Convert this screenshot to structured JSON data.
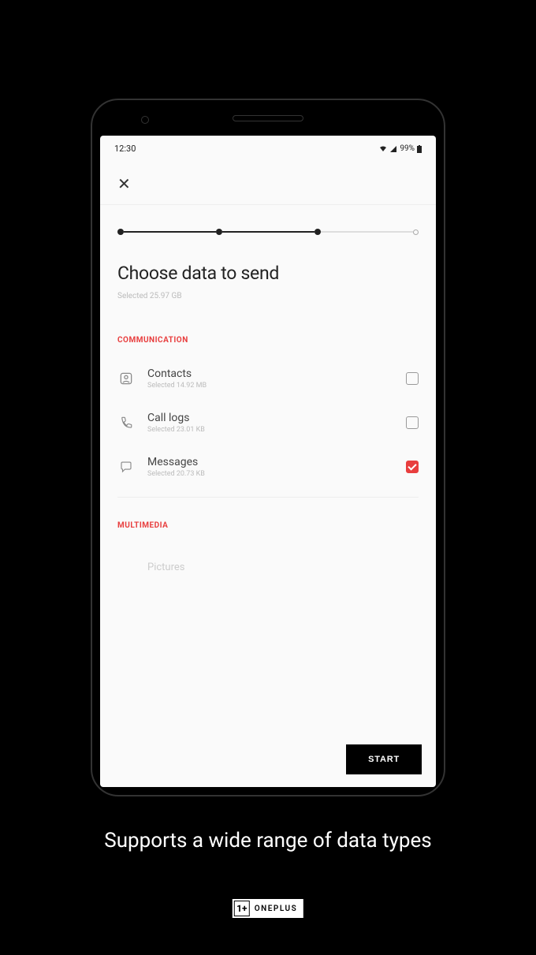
{
  "statusBar": {
    "time": "12:30",
    "battery": "99%"
  },
  "page": {
    "title": "Choose data to send",
    "subtitle": "Selected 25.97 GB"
  },
  "sections": {
    "communication": {
      "label": "COMMUNICATION",
      "items": [
        {
          "title": "Contacts",
          "subtitle": "Selected 14.92 MB",
          "checked": false
        },
        {
          "title": "Call logs",
          "subtitle": "Selected 23.01 KB",
          "checked": false
        },
        {
          "title": "Messages",
          "subtitle": "Selected 20.73 KB",
          "checked": true
        }
      ]
    },
    "multimedia": {
      "label": "MULTIMEDIA",
      "items": [
        {
          "title": "Pictures"
        }
      ]
    }
  },
  "startButton": "START",
  "caption": "Supports a wide range of data types",
  "brand": "ONEPLUS"
}
